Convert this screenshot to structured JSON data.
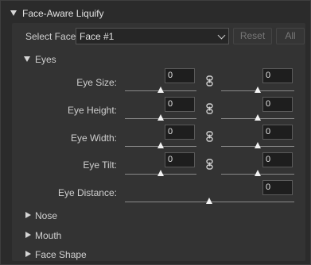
{
  "panel": {
    "title": "Face-Aware Liquify",
    "select_face_label": "Select Face:",
    "select_face_value": "Face #1",
    "reset_label": "Reset",
    "all_label": "All"
  },
  "eyes": {
    "title": "Eyes",
    "rows": [
      {
        "label": "Eye Size:",
        "left_value": "0",
        "right_value": "0"
      },
      {
        "label": "Eye Height:",
        "left_value": "0",
        "right_value": "0"
      },
      {
        "label": "Eye Width:",
        "left_value": "0",
        "right_value": "0"
      },
      {
        "label": "Eye Tilt:",
        "left_value": "0",
        "right_value": "0"
      }
    ],
    "distance_label": "Eye Distance:",
    "distance_value": "0"
  },
  "collapsed_sections": [
    {
      "label": "Nose"
    },
    {
      "label": "Mouth"
    },
    {
      "label": "Face Shape"
    }
  ]
}
